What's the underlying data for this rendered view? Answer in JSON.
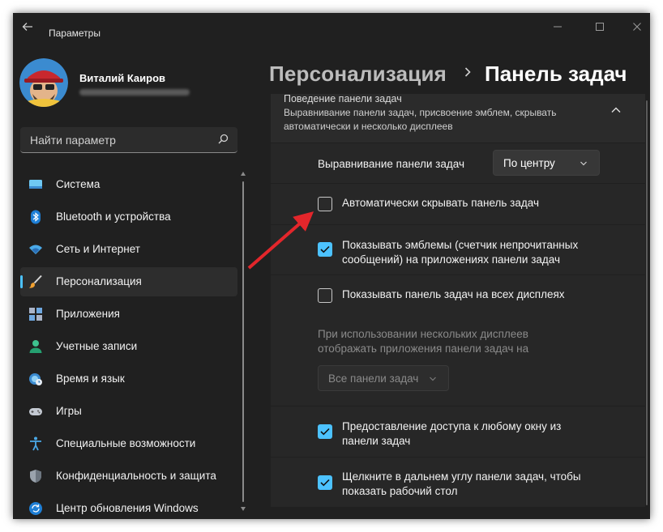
{
  "window": {
    "title": "Параметры"
  },
  "user": {
    "name": "Виталий Каиров"
  },
  "search": {
    "placeholder": "Найти параметр"
  },
  "nav": {
    "items": [
      {
        "label": "Система",
        "icon": "monitor-icon"
      },
      {
        "label": "Bluetooth и устройства",
        "icon": "bluetooth-icon"
      },
      {
        "label": "Сеть и Интернет",
        "icon": "wifi-icon"
      },
      {
        "label": "Персонализация",
        "icon": "brush-icon",
        "active": true
      },
      {
        "label": "Приложения",
        "icon": "apps-icon"
      },
      {
        "label": "Учетные записи",
        "icon": "person-icon"
      },
      {
        "label": "Время и язык",
        "icon": "globe-clock-icon"
      },
      {
        "label": "Игры",
        "icon": "gamepad-icon"
      },
      {
        "label": "Специальные возможности",
        "icon": "accessibility-icon"
      },
      {
        "label": "Конфиденциальность и защита",
        "icon": "shield-icon"
      },
      {
        "label": "Центр обновления Windows",
        "icon": "update-icon"
      }
    ]
  },
  "breadcrumb": {
    "parent": "Персонализация",
    "separator": "›",
    "current": "Панель задач"
  },
  "section": {
    "title": "Поведение панели задач",
    "description": "Выравнивание панели задач, присвоение эмблем, скрывать автоматически и несколько дисплеев"
  },
  "settings": {
    "alignment": {
      "label": "Выравнивание панели задач",
      "value": "По центру"
    },
    "autohide": {
      "label": "Автоматически скрывать панель задач",
      "checked": false
    },
    "badges": {
      "label_line1": "Показывать эмблемы (счетчик непрочитанных",
      "label_line2": "сообщений) на приложениях панели задач",
      "checked": true
    },
    "all_displays": {
      "label": "Показывать панель задач на всех дисплеях",
      "checked": false
    },
    "multi_display": {
      "label_line1": "При использовании нескольких дисплеев",
      "label_line2": "отображать приложения панели задач на",
      "value": "Все панели задач",
      "enabled": false
    },
    "share_window": {
      "label_line1": "Предоставление доступа к любому окну из",
      "label_line2": "панели задач",
      "checked": true
    },
    "far_corner": {
      "label_line1": "Щелкните в дальнем углу панели задач, чтобы",
      "label_line2": "показать рабочий стол",
      "checked": true
    }
  },
  "colors": {
    "accent": "#4cc2ff",
    "background": "#202020",
    "card": "#2b2b2b",
    "annotation_arrow": "#e3262b"
  }
}
